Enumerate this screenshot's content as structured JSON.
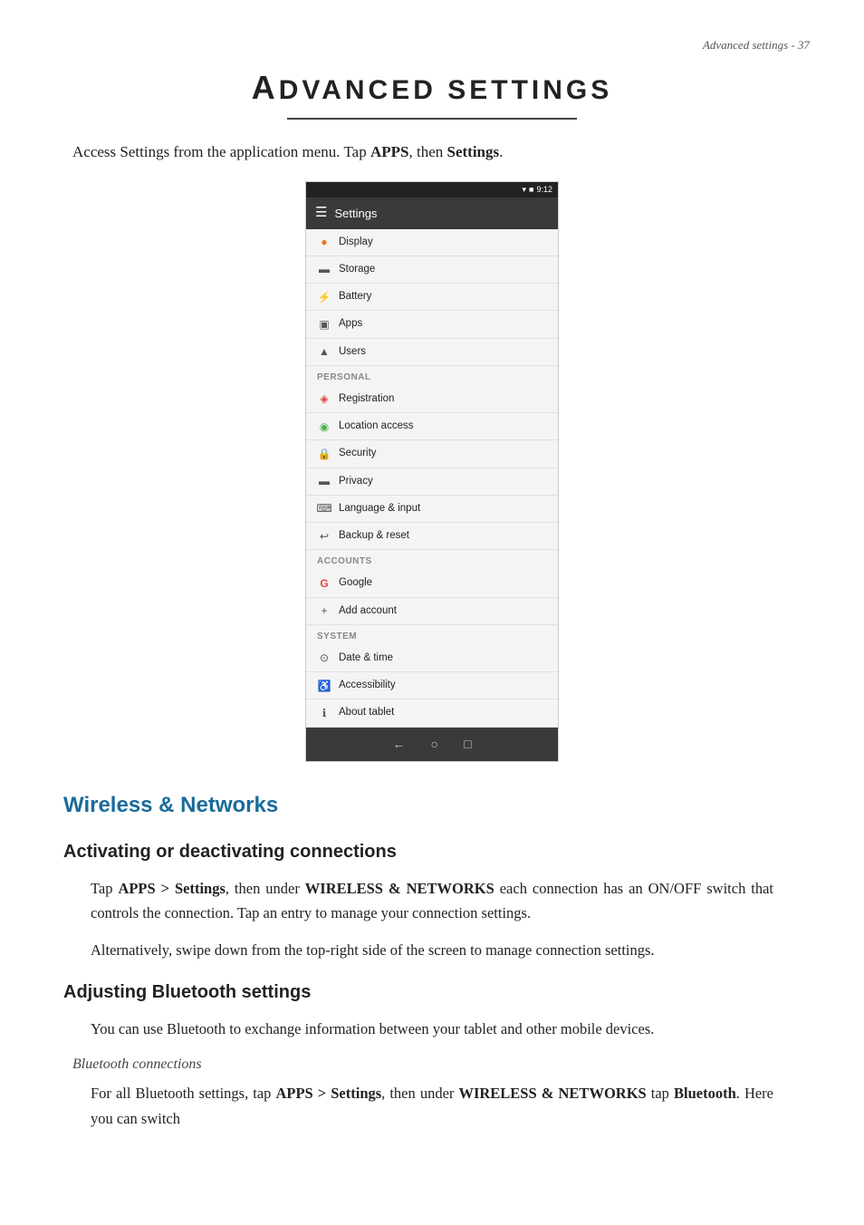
{
  "page": {
    "page_number": "Advanced settings - 37",
    "chapter_title": "Advanced Settings",
    "chapter_title_prefix": "A",
    "chapter_title_rest": "dvanced settings",
    "title_underline": true
  },
  "intro": {
    "text_before": "Access Settings from the application menu. Tap ",
    "bold1": "APPS",
    "text_middle": ", then ",
    "bold2": "Settings",
    "text_after": "."
  },
  "screenshot": {
    "statusbar": {
      "wifi": "▼ ■ 9:12",
      "battery": ""
    },
    "header": {
      "icon": "☰",
      "title": "Settings"
    },
    "items": [
      {
        "icon": "●",
        "icon_color": "icon-orange",
        "label": "Display",
        "section": null
      },
      {
        "icon": "▬",
        "icon_color": "icon-gray",
        "label": "Storage",
        "section": null
      },
      {
        "icon": "⚡",
        "icon_color": "icon-gray",
        "label": "Battery",
        "section": null
      },
      {
        "icon": "▣",
        "icon_color": "icon-gray",
        "label": "Apps",
        "section": null
      },
      {
        "icon": "▲",
        "icon_color": "icon-gray",
        "label": "Users",
        "section": null
      },
      {
        "section_label": "PERSONAL",
        "icon": null,
        "label": null
      },
      {
        "icon": "◈",
        "icon_color": "icon-red",
        "label": "Registration",
        "section": null
      },
      {
        "icon": "◉",
        "icon_color": "icon-green",
        "label": "Location access",
        "section": null
      },
      {
        "icon": "🔒",
        "icon_color": "icon-gray",
        "label": "Security",
        "section": null
      },
      {
        "icon": "▬",
        "icon_color": "icon-gray",
        "label": "Privacy",
        "section": null
      },
      {
        "icon": "⌨",
        "icon_color": "icon-gray",
        "label": "Language & input",
        "section": null
      },
      {
        "icon": "↩",
        "icon_color": "icon-gray",
        "label": "Backup & reset",
        "section": null
      },
      {
        "section_label": "ACCOUNTS",
        "icon": null,
        "label": null
      },
      {
        "icon": "G",
        "icon_color": "icon-g-red",
        "label": "Google",
        "section": null
      },
      {
        "icon": "+",
        "icon_color": "icon-gray",
        "label": "Add account",
        "section": null
      },
      {
        "section_label": "SYSTEM",
        "icon": null,
        "label": null
      },
      {
        "icon": "⊙",
        "icon_color": "icon-gray",
        "label": "Date & time",
        "section": null
      },
      {
        "icon": "♿",
        "icon_color": "icon-orange",
        "label": "Accessibility",
        "section": null
      },
      {
        "icon": "ℹ",
        "icon_color": "icon-gray",
        "label": "About tablet",
        "section": null
      }
    ],
    "navbar": [
      "←",
      "○",
      "□"
    ]
  },
  "sections": [
    {
      "id": "wireless",
      "title": "Wireless & Networks",
      "is_blue": true,
      "subsections": [
        {
          "id": "activating",
          "title": "Activating or deactivating connections",
          "paragraphs": [
            {
              "parts": [
                {
                  "text": "Tap ",
                  "bold": false
                },
                {
                  "text": "APPS > Settings",
                  "bold": true
                },
                {
                  "text": ", then under ",
                  "bold": false
                },
                {
                  "text": "WIRELESS & NETWORKS",
                  "bold": true
                },
                {
                  "text": " each connection has an ON/OFF switch that controls the connection. Tap an entry to manage your connection settings.",
                  "bold": false
                }
              ]
            },
            {
              "parts": [
                {
                  "text": "Alternatively, swipe down from the top-right side of the screen to manage connection settings.",
                  "bold": false
                }
              ]
            }
          ]
        },
        {
          "id": "bluetooth",
          "title": "Adjusting Bluetooth settings",
          "paragraphs": [
            {
              "parts": [
                {
                  "text": "You can use Bluetooth to exchange information between your tablet and other mobile devices.",
                  "bold": false
                }
              ]
            }
          ],
          "subheadings": [
            {
              "id": "bt-connections",
              "label": "Bluetooth connections",
              "paragraphs": [
                {
                  "parts": [
                    {
                      "text": "For all Bluetooth settings, tap ",
                      "bold": false
                    },
                    {
                      "text": "APPS > Settings",
                      "bold": true
                    },
                    {
                      "text": ", then under ",
                      "bold": false
                    },
                    {
                      "text": "WIRELESS & NETWORKS",
                      "bold": true
                    },
                    {
                      "text": " tap ",
                      "bold": false
                    },
                    {
                      "text": "Bluetooth",
                      "bold": true
                    },
                    {
                      "text": ". Here you can switch",
                      "bold": false
                    }
                  ]
                }
              ]
            }
          ]
        }
      ]
    }
  ]
}
